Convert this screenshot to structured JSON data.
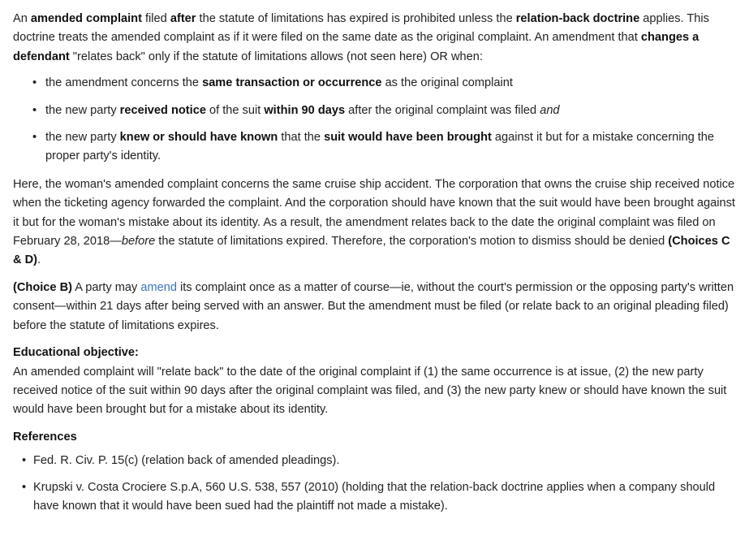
{
  "intro": {
    "t1": "An ",
    "b1": "amended complaint",
    "t2": " filed ",
    "b2": "after",
    "t3": " the statute of limitations has expired is prohibited unless the ",
    "b3": "relation-back doctrine",
    "t4": " applies.  This doctrine treats the amended complaint as if it were filed on the same date as the original complaint.  An amendment that ",
    "b4": "changes a defendant",
    "t5": " \"relates back\" only if the statute of limitations allows (not seen here) OR when:"
  },
  "rules": [
    {
      "t1": "the amendment concerns the ",
      "b1": "same transaction or occurrence",
      "t2": " as the original complaint"
    },
    {
      "t1": "the new party ",
      "b1": "received notice",
      "t2": " of the suit ",
      "b2": "within 90 days",
      "t3": " after the original complaint was filed ",
      "i1": "and"
    },
    {
      "t1": "the new party ",
      "b1": "knew or should have known",
      "t2": " that the ",
      "b2": "suit would have been brought",
      "t3": " against it but for a mistake concerning the proper party's identity."
    }
  ],
  "here": {
    "t1": "Here, the woman's amended complaint concerns the same cruise ship accident.  The corporation that owns the cruise ship received notice when the ticketing agency forwarded the complaint.  And the corporation should have known that the suit would have been brought against it but for the woman's mistake about its identity.  As a result, the amendment relates back to the date the original complaint was filed on February 28, 2018—",
    "i1": "before",
    "t2": " the statute of limitations expired.  Therefore, the corporation's motion to dismiss should be denied ",
    "b1": "(Choices C & D)",
    "t3": "."
  },
  "choice_b": {
    "b1": "(Choice B)",
    "t1": "  A party may ",
    "link": "amend",
    "t2": " its complaint once as a matter of course—ie, without the court's permission or the opposing party's written consent—within 21 days after being served with an answer.  But the amendment must be filed (or relate back to an original pleading filed) before the statute of limitations expires."
  },
  "educational": {
    "heading": "Educational objective:",
    "text": "An amended complaint will \"relate back\" to the date of the original complaint if (1) the same occurrence is at issue, (2) the new party received notice of the suit within 90 days after the original complaint was filed, and (3) the new party knew or should have known the suit would have been brought but for a mistake about its identity."
  },
  "references": {
    "heading": "References",
    "items": [
      "Fed. R. Civ. P. 15(c) (relation back of amended pleadings).",
      "Krupski v. Costa Crociere S.p.A, 560 U.S. 538, 557 (2010) (holding that the relation-back doctrine applies when a company should have known that it would have been sued had the plaintiff not made a mistake)."
    ]
  },
  "colors": {
    "text": "#222222",
    "link": "#3b73b9",
    "background": "#ffffff"
  }
}
